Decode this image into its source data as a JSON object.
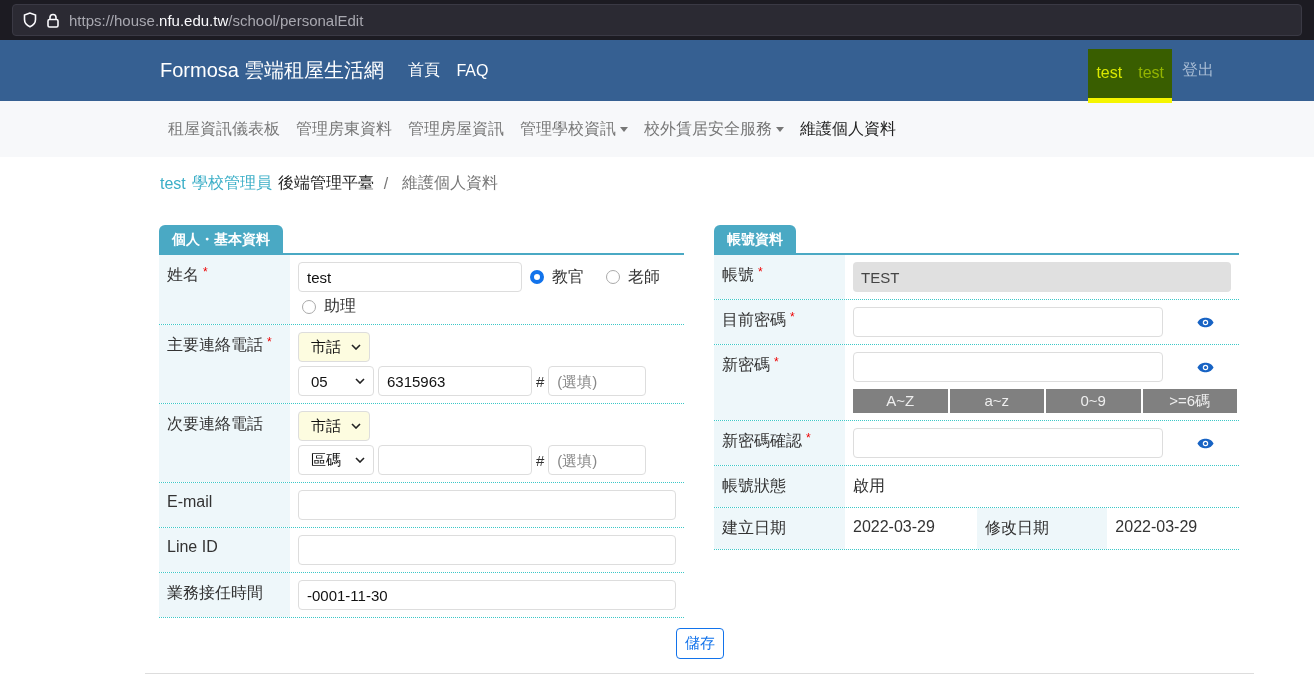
{
  "browser": {
    "url_start": "https://house.",
    "url_domain": "nfu.edu.tw",
    "url_path": "/school/personalEdit"
  },
  "navbar": {
    "brand": "Formosa 雲端租屋生活網",
    "links": [
      "首頁",
      "FAQ"
    ],
    "user_links": [
      "test",
      "test"
    ],
    "logout": "登出"
  },
  "subnav": [
    {
      "label": "租屋資訊儀表板",
      "dropdown": false,
      "selected": false
    },
    {
      "label": "管理房東資料",
      "dropdown": false,
      "selected": false
    },
    {
      "label": "管理房屋資訊",
      "dropdown": false,
      "selected": false
    },
    {
      "label": "管理學校資訊",
      "dropdown": true,
      "selected": false
    },
    {
      "label": "校外賃居安全服務",
      "dropdown": true,
      "selected": false
    },
    {
      "label": "維護個人資料",
      "dropdown": false,
      "selected": true
    }
  ],
  "breadcrumb": {
    "user": "test",
    "role": "學校管理員",
    "platform": "後端管理平臺",
    "separator": "/",
    "current": "維護個人資料"
  },
  "personal_panel": {
    "title": "個人・基本資料",
    "rows": [
      {
        "kind": "name",
        "label": "姓名",
        "required_mark": "*",
        "value": "test",
        "options": [
          {
            "label": "教官",
            "selected": true
          },
          {
            "label": "老師",
            "selected": false
          },
          {
            "label": "助理",
            "selected": false
          }
        ]
      },
      {
        "kind": "phone",
        "label": "主要連絡電話",
        "required_mark": "*",
        "type": "市話",
        "area": "05",
        "number": "6315963",
        "hash": "#",
        "ext_placeholder": "(選填)"
      },
      {
        "kind": "phone",
        "label": "次要連絡電話",
        "type": "市話",
        "area": "區碼",
        "hash": "#",
        "ext_placeholder": "(選填)"
      },
      {
        "kind": "text",
        "label": "E-mail"
      },
      {
        "kind": "text",
        "label": "Line ID"
      },
      {
        "kind": "text",
        "label": "業務接任時間",
        "value": "-0001-11-30"
      }
    ]
  },
  "account_panel": {
    "title": "帳號資料",
    "rows": [
      {
        "kind": "readonly",
        "label": "帳號",
        "required_mark": "*",
        "value": "TEST"
      },
      {
        "kind": "password",
        "label": "目前密碼",
        "required_mark": "*"
      },
      {
        "kind": "password",
        "label": "新密碼",
        "required_mark": "*",
        "rules": [
          {
            "label": "A~Z",
            "met": false
          },
          {
            "label": "a~z",
            "met": false
          },
          {
            "label": "0~9",
            "met": false
          },
          {
            "label": ">=6碼",
            "met": false
          }
        ]
      },
      {
        "kind": "password",
        "label": "新密碼確認",
        "required_mark": "*"
      },
      {
        "kind": "plain",
        "label": "帳號狀態",
        "value": "啟用"
      },
      {
        "kind": "dates",
        "label": "建立日期",
        "value": "2022-03-29",
        "label_2": "修改日期",
        "value_2": "2022-03-29"
      }
    ]
  },
  "save_button": "儲存"
}
